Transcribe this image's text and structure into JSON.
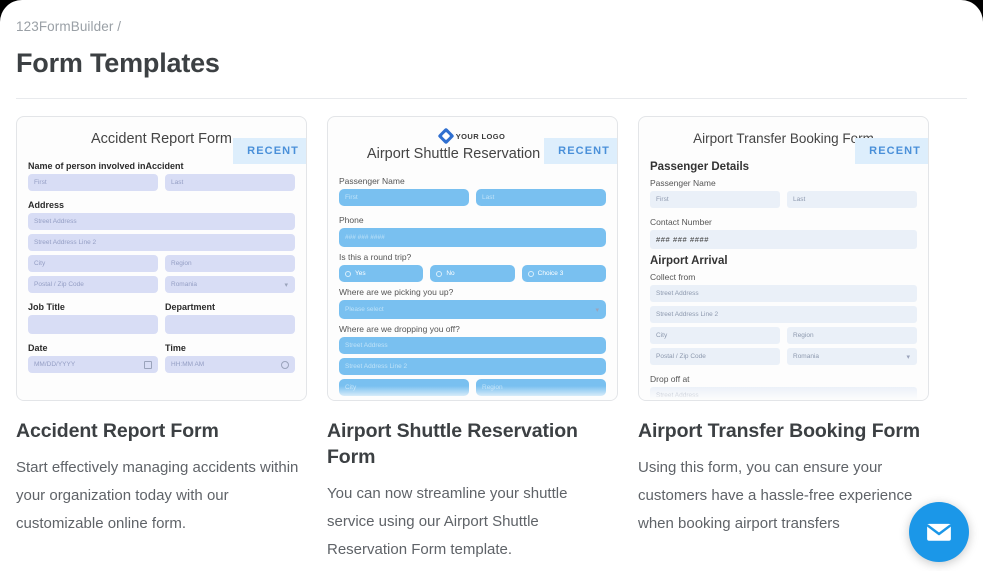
{
  "header": {
    "breadcrumb": "123FormBuilder /",
    "title": "Form Templates"
  },
  "badge_label": "RECENT",
  "colors": {
    "accent_blue": "#4a90d9",
    "badge_bg": "#ddeefc",
    "chat_blue": "#1b97e8",
    "field_lavender": "#d8ddf5",
    "field_blue": "#79c0f0",
    "field_pale": "#eaf0f8"
  },
  "cards": [
    {
      "title": "Accident Report Form",
      "description": "Start effectively managing accidents within your organization today with our customizable online form.",
      "badge": "RECENT",
      "preview": {
        "form_title": "Accident Report Form",
        "labels": {
          "name": "Name of person involved inAccident",
          "address": "Address",
          "job_title": "Job Title",
          "department": "Department",
          "date": "Date",
          "time": "Time"
        },
        "fields": {
          "first": "First",
          "last": "Last",
          "street": "Street Address",
          "street2": "Street Address Line 2",
          "city": "City",
          "region": "Region",
          "zip": "Postal / Zip Code",
          "country": "Romania",
          "job_title_value": "",
          "department_value": "",
          "date_value": "MM/DD/YYYY",
          "time_value": "HH:MM AM"
        }
      }
    },
    {
      "title": "Airport Shuttle Reservation Form",
      "description": "You can now streamline your shuttle service using our Airport Shuttle Reservation Form template.",
      "badge": "RECENT",
      "preview": {
        "logo_text": "YOUR LOGO",
        "form_title": "Airport Shuttle Reservation Form",
        "labels": {
          "passenger_name": "Passenger Name",
          "phone": "Phone",
          "round_trip": "Is this a round trip?",
          "pickup": "Where are we picking you up?",
          "dropoff": "Where are we dropping you off?"
        },
        "fields": {
          "first": "First",
          "last": "Last",
          "phone_value": "### ### ####",
          "select": "Please select",
          "street": "Street Address",
          "street2": "Street Address Line 2",
          "city": "City",
          "region": "Region"
        },
        "choices": [
          "Yes",
          "No",
          "Choice 3"
        ]
      }
    },
    {
      "title": "Airport Transfer Booking Form",
      "description": "Using this form, you can ensure your customers have a hassle-free experience when booking airport transfers",
      "badge": "RECENT",
      "preview": {
        "form_title": "Airport Transfer Booking Form",
        "sections": {
          "passenger_details": "Passenger Details",
          "airport_arrival": "Airport Arrival"
        },
        "labels": {
          "passenger_name": "Passenger Name",
          "contact_number": "Contact Number",
          "collect_from": "Collect from",
          "drop_off_at": "Drop off at"
        },
        "fields": {
          "first": "First",
          "last": "Last",
          "contact_value": "### ### ####",
          "street": "Street Address",
          "street2": "Street Address Line 2",
          "city": "City",
          "region": "Region",
          "zip": "Postal / Zip Code",
          "country": "Romania",
          "dropoff_street": "Street Address"
        }
      }
    }
  ],
  "chat": {
    "icon": "envelope-icon"
  }
}
